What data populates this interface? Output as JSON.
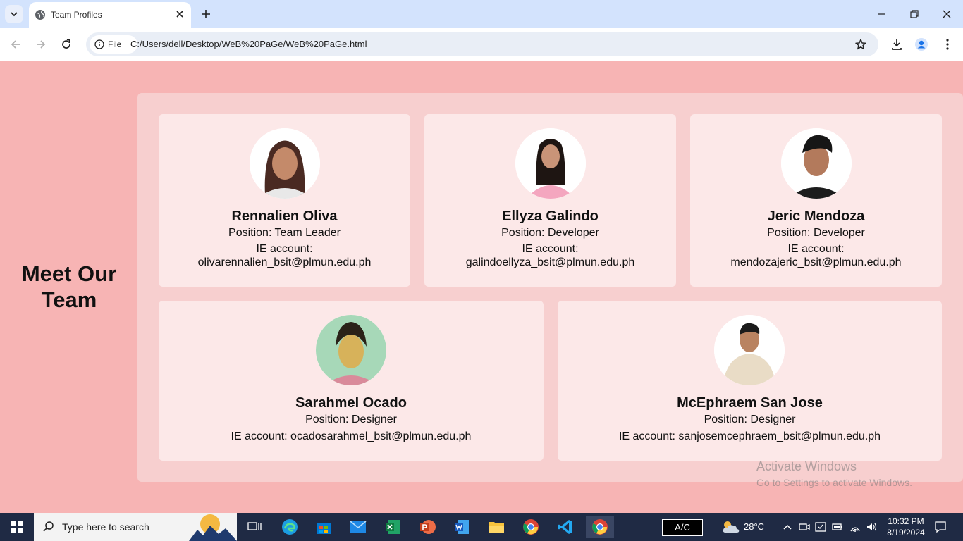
{
  "browser": {
    "tab_title": "Team Profiles",
    "chip_label": "File",
    "url": "C:/Users/dell/Desktop/WeB%20PaGe/WeB%20PaGe.html"
  },
  "page": {
    "heading": "Meet Our Team",
    "members": [
      {
        "name": "Rennalien Oliva",
        "position": "Position: Team Leader",
        "account_label": "IE account:",
        "account": "olivarennalien_bsit@plmun.edu.ph"
      },
      {
        "name": "Ellyza Galindo",
        "position": "Position: Developer",
        "account_label": "IE account:",
        "account": "galindoellyza_bsit@plmun.edu.ph"
      },
      {
        "name": "Jeric Mendoza",
        "position": "Position: Developer",
        "account_label": "IE account:",
        "account": "mendozajeric_bsit@plmun.edu.ph"
      },
      {
        "name": "Sarahmel Ocado",
        "position": "Position: Designer",
        "account_full": "IE account: ocadosarahmel_bsit@plmun.edu.ph"
      },
      {
        "name": "McEphraem San Jose",
        "position": "Position: Designer",
        "account_full": "IE account: sanjosemcephraem_bsit@plmun.edu.ph"
      }
    ],
    "watermark": {
      "line1": "Activate Windows",
      "line2": "Go to Settings to activate Windows."
    }
  },
  "taskbar": {
    "search_placeholder": "Type here to search",
    "ac_label": "A/C",
    "temperature": "28°C",
    "time": "10:32 PM",
    "date": "8/19/2024"
  },
  "colors": {
    "page_bg": "#f7b4b4",
    "panel_bg": "#f7cfcf",
    "card_bg": "#fce8e8"
  }
}
